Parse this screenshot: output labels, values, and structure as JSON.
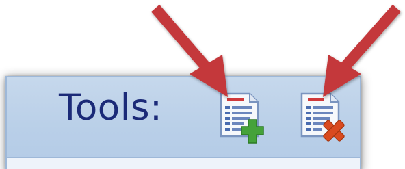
{
  "toolbar": {
    "label": "Tools:",
    "buttons": [
      {
        "name": "add-row-button",
        "icon": "document-add-icon"
      },
      {
        "name": "delete-row-button",
        "icon": "document-delete-icon"
      }
    ]
  },
  "annotations": {
    "arrows": [
      {
        "name": "arrow-to-add-button",
        "color": "#c4373a"
      },
      {
        "name": "arrow-to-delete-button",
        "color": "#c4373a"
      }
    ]
  },
  "colors": {
    "panel_bg": "#bcd1ea",
    "label_text": "#1b2a78",
    "arrow": "#c4373a",
    "add_plus": "#3f9a35",
    "delete_x": "#d04a1e"
  }
}
